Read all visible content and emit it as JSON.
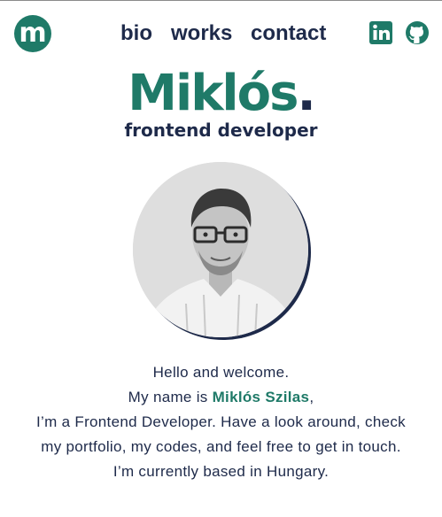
{
  "header": {
    "logo_letter": "m",
    "nav": [
      "bio",
      "works",
      "contact"
    ],
    "social": [
      "linkedin-icon",
      "github-icon"
    ]
  },
  "hero": {
    "name": "Miklós",
    "name_dot": ".",
    "subtitle": "frontend developer"
  },
  "intro": {
    "line1": "Hello and welcome.",
    "line2_prefix": "My name is ",
    "line2_name": "Miklós Szilas",
    "line2_suffix": ",",
    "line3": "I’m a Frontend Developer. Have a look around, check",
    "line4": "my portfolio, my codes, and feel free to get in touch.",
    "line5": "I’m currently based in Hungary."
  },
  "colors": {
    "accent": "#1f7a68",
    "dark": "#1e2a4a",
    "background": "#ffffff"
  }
}
